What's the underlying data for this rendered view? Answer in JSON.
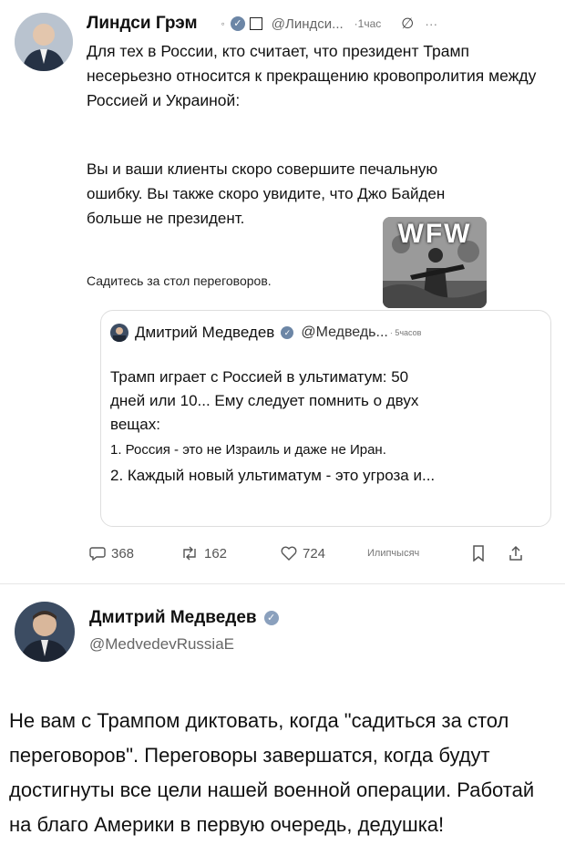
{
  "post": {
    "author_name": "Линдси Грэм",
    "handle": "@Линдси...",
    "time": "·1час",
    "paragraphs": [
      "Для тех в России, кто считает, что президент Трамп несерьезно относится к прекращению кровопролития между Россией и Украиной:",
      "Вы и ваши клиенты скоро совершите печальную ошибку. Вы также скоро увидите, что Джо Байден больше не президент."
    ],
    "sign_off": "Садитесь за стол переговоров.",
    "image_text": "WFW"
  },
  "quote": {
    "author_name": "Дмитрий Медведев",
    "handle": "@Медведь...",
    "time": "· 5часов",
    "lines": [
      "Трамп играет с Россией в ультиматум: 50 дней или 10... Ему следует помнить о двух вещах:",
      "1. Россия - это не Израиль и даже не Иран.",
      "2. Каждый новый ультиматум - это угроза и..."
    ]
  },
  "actions": {
    "replies": "368",
    "reposts": "162",
    "likes": "724",
    "views": "Илипчысяч"
  },
  "reply": {
    "author_name": "Дмитрий Медведев",
    "handle": "@MedvedevRussiaE",
    "text": "Не вам с Трампом диктовать, когда \"садиться за стол переговоров\". Переговоры завершатся, когда будут достигнуты все цели нашей военной операции. Работай на благо Америки в первую очередь, дедушка!"
  }
}
